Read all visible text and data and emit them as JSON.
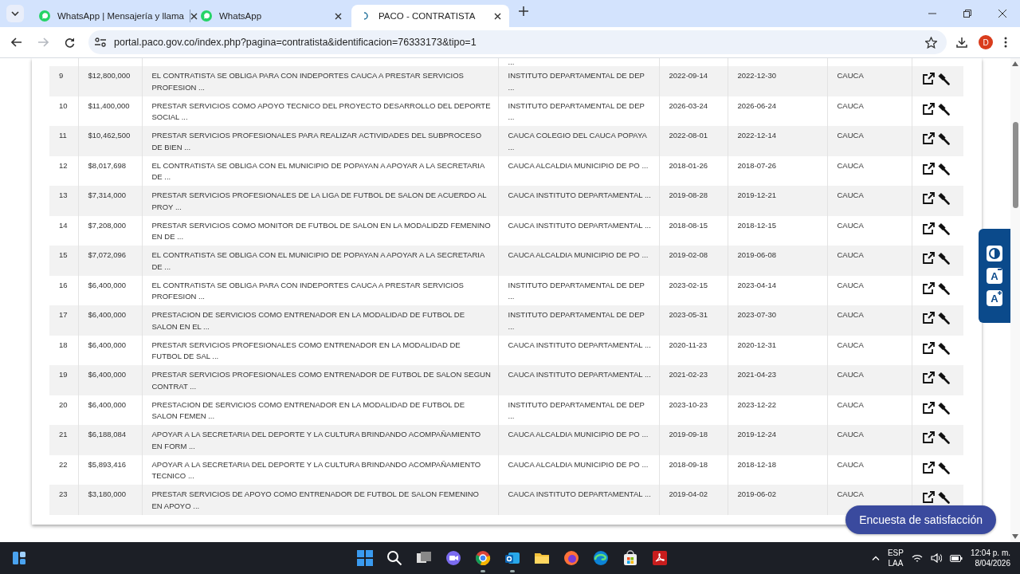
{
  "browser": {
    "tabs": [
      {
        "title": "WhatsApp | Mensajería y llama",
        "kind": "whatsapp",
        "selected": false
      },
      {
        "title": "WhatsApp",
        "kind": "whatsapp",
        "selected": false
      },
      {
        "title": "PACO - CONTRATISTA",
        "kind": "paco",
        "selected": true
      }
    ],
    "url": "portal.paco.gov.co/index.php?pagina=contratista&identificacion=76333173&tipo=1",
    "forward_disabled": true,
    "profile": "D"
  },
  "table": {
    "partial_row": {
      "entity": "..."
    },
    "rows": [
      {
        "number": "9",
        "value": "$12,800,000",
        "object": "EL CONTRATISTA SE OBLIGA PARA CON INDEPORTES CAUCA A PRESTAR SERVICIOS PROFESION ...",
        "entity": "INSTITUTO DEPARTAMENTAL DE DEP ...",
        "start": "2022-09-14",
        "end": "2022-12-30",
        "department": "CAUCA"
      },
      {
        "number": "10",
        "value": "$11,400,000",
        "object": "PRESTAR SERVICIOS COMO APOYO TECNICO DEL PROYECTO DESARROLLO DEL DEPORTE SOCIAL ...",
        "entity": "INSTITUTO DEPARTAMENTAL DE DEP ...",
        "start": "2026-03-24",
        "end": "2026-06-24",
        "department": "CAUCA"
      },
      {
        "number": "11",
        "value": "$10,462,500",
        "object": "PRESTAR SERVICIOS PROFESIONALES PARA REALIZAR ACTIVIDADES DEL SUBPROCESO DE BIEN ...",
        "entity": "CAUCA COLEGIO DEL CAUCA POPAYA ...",
        "start": "2022-08-01",
        "end": "2022-12-14",
        "department": "CAUCA"
      },
      {
        "number": "12",
        "value": "$8,017,698",
        "object": "EL CONTRATISTA SE OBLIGA CON EL MUNICIPIO DE POPAYAN A APOYAR A LA SECRETARIA DE ...",
        "entity": "CAUCA ALCALDIA MUNICIPIO DE PO ...",
        "start": "2018-01-26",
        "end": "2018-07-26",
        "department": "CAUCA"
      },
      {
        "number": "13",
        "value": "$7,314,000",
        "object": "PRESTAR SERVICIOS PROFESIONALES DE LA LIGA DE FUTBOL DE SALON DE ACUERDO AL PROY ...",
        "entity": "CAUCA INSTITUTO DEPARTAMENTAL ...",
        "start": "2019-08-28",
        "end": "2019-12-21",
        "department": "CAUCA"
      },
      {
        "number": "14",
        "value": "$7,208,000",
        "object": "PRESTAR SERVICIOS COMO MONITOR DE FUTBOL DE SALON EN LA MODALIDZD FEMENINO EN DE ...",
        "entity": "CAUCA INSTITUTO DEPARTAMENTAL ...",
        "start": "2018-08-15",
        "end": "2018-12-15",
        "department": "CAUCA"
      },
      {
        "number": "15",
        "value": "$7,072,096",
        "object": "EL CONTRATISTA SE OBLIGA CON EL MUNICIPIO DE POPAYAN A APOYAR A LA SECRETARIA DE ...",
        "entity": "CAUCA ALCALDIA MUNICIPIO DE PO ...",
        "start": "2019-02-08",
        "end": "2019-06-08",
        "department": "CAUCA"
      },
      {
        "number": "16",
        "value": "$6,400,000",
        "object": "EL CONTRATISTA SE OBLIGA PARA CON INDEPORTES CAUCA A PRESTAR SERVICIOS PROFESION ...",
        "entity": "INSTITUTO DEPARTAMENTAL DE DEP ...",
        "start": "2023-02-15",
        "end": "2023-04-14",
        "department": "CAUCA"
      },
      {
        "number": "17",
        "value": "$6,400,000",
        "object": "PRESTACION DE SERVICIOS COMO ENTRENADOR EN LA MODALIDAD DE FUTBOL DE SALON EN EL ...",
        "entity": "INSTITUTO DEPARTAMENTAL DE DEP ...",
        "start": "2023-05-31",
        "end": "2023-07-30",
        "department": "CAUCA"
      },
      {
        "number": "18",
        "value": "$6,400,000",
        "object": "PRESTAR SERVICIOS PROFESIONALES COMO ENTRENADOR EN LA MODALIDAD DE FUTBOL DE SAL ...",
        "entity": "CAUCA INSTITUTO DEPARTAMENTAL ...",
        "start": "2020-11-23",
        "end": "2020-12-31",
        "department": "CAUCA"
      },
      {
        "number": "19",
        "value": "$6,400,000",
        "object": "PRESTAR SERVICIOS PROFESIONALES COMO ENTRENADOR DE FUTBOL DE SALON SEGUN CONTRAT ...",
        "entity": "CAUCA INSTITUTO DEPARTAMENTAL ...",
        "start": "2021-02-23",
        "end": "2021-04-23",
        "department": "CAUCA"
      },
      {
        "number": "20",
        "value": "$6,400,000",
        "object": "PRESTACION DE SERVICIOS COMO ENTRENADOR EN LA MODALIDAD DE FUTBOL DE SALON FEMEN ...",
        "entity": "INSTITUTO DEPARTAMENTAL DE DEP ...",
        "start": "2023-10-23",
        "end": "2023-12-22",
        "department": "CAUCA"
      },
      {
        "number": "21",
        "value": "$6,188,084",
        "object": "APOYAR A LA SECRETARIA DEL DEPORTE Y LA CULTURA BRINDANDO ACOMPAÑAMIENTO EN FORM ...",
        "entity": "CAUCA ALCALDIA MUNICIPIO DE PO ...",
        "start": "2019-09-18",
        "end": "2019-12-24",
        "department": "CAUCA"
      },
      {
        "number": "22",
        "value": "$5,893,416",
        "object": "APOYAR A LA SECRETARIA DEL DEPORTE Y LA CULTURA BRINDANDO ACOMPAÑAMIENTO TECNICO ...",
        "entity": "CAUCA ALCALDIA MUNICIPIO DE PO ...",
        "start": "2018-09-18",
        "end": "2018-12-18",
        "department": "CAUCA"
      },
      {
        "number": "23",
        "value": "$3,180,000",
        "object": "PRESTAR SERVICIOS DE APOYO COMO ENTRENADOR DE FUTBOL DE SALON FEMENINO EN APOYO ...",
        "entity": "CAUCA INSTITUTO DEPARTAMENTAL ...",
        "start": "2019-04-02",
        "end": "2019-06-02",
        "department": "CAUCA"
      }
    ]
  },
  "accessibility": {
    "buttons": [
      {
        "kind": "contrast"
      },
      {
        "kind": "decrease",
        "label": "A"
      },
      {
        "kind": "increase",
        "label": "A"
      }
    ]
  },
  "survey_button": "Encuesta de satisfacción",
  "taskbar": {
    "apps": [
      {
        "kind": "start"
      },
      {
        "kind": "search"
      },
      {
        "kind": "taskview"
      },
      {
        "kind": "meet"
      },
      {
        "kind": "chrome",
        "running": true
      },
      {
        "kind": "outlook",
        "running": true
      },
      {
        "kind": "files",
        "running": false
      },
      {
        "kind": "firefox",
        "running": false
      },
      {
        "kind": "edge",
        "running": false
      },
      {
        "kind": "store",
        "running": false
      },
      {
        "kind": "pdf",
        "running": false
      }
    ],
    "language": "ESP",
    "layout": "LAA",
    "time": "12:04 p. m.",
    "date": "8/04/2026"
  }
}
